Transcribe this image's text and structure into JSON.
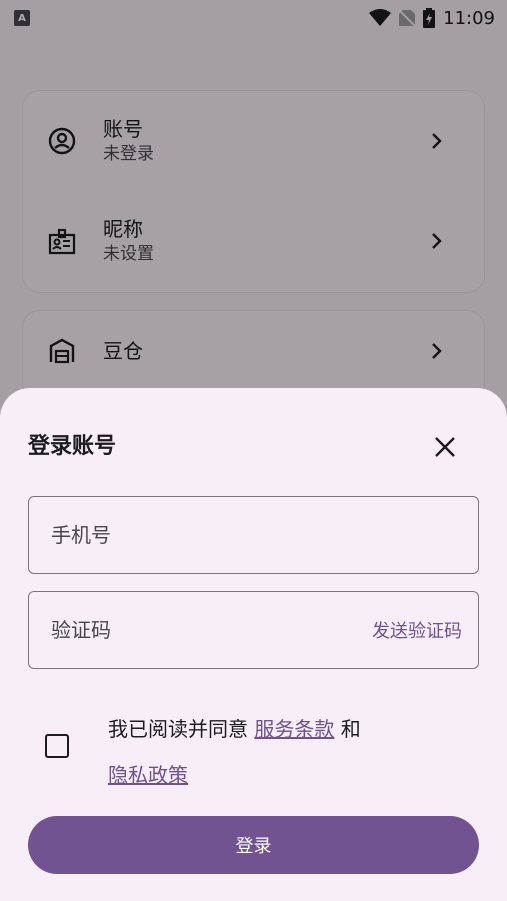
{
  "status_bar": {
    "left_badge": "A",
    "time": "11:09",
    "icons": [
      "wifi-icon",
      "no-sim-icon",
      "battery-charging-icon"
    ]
  },
  "background": {
    "rows": [
      {
        "title": "账号",
        "subtitle": "未登录",
        "icon": "account-circle-icon"
      },
      {
        "title": "昵称",
        "subtitle": "未设置",
        "icon": "badge-icon"
      },
      {
        "title": "豆仓",
        "subtitle": "",
        "icon": "warehouse-icon"
      }
    ]
  },
  "sheet": {
    "title": "登录账号",
    "phone_placeholder": "手机号",
    "code_placeholder": "验证码",
    "send_code_label": "发送验证码",
    "agree_prefix": "我已阅读并同意",
    "terms_link": "服务条款",
    "agree_and": "和",
    "privacy_link": "隐私政策",
    "login_label": "登录"
  },
  "colors": {
    "accent": "#725391",
    "link": "#6e5290",
    "sheet_bg": "#f8eef8"
  }
}
